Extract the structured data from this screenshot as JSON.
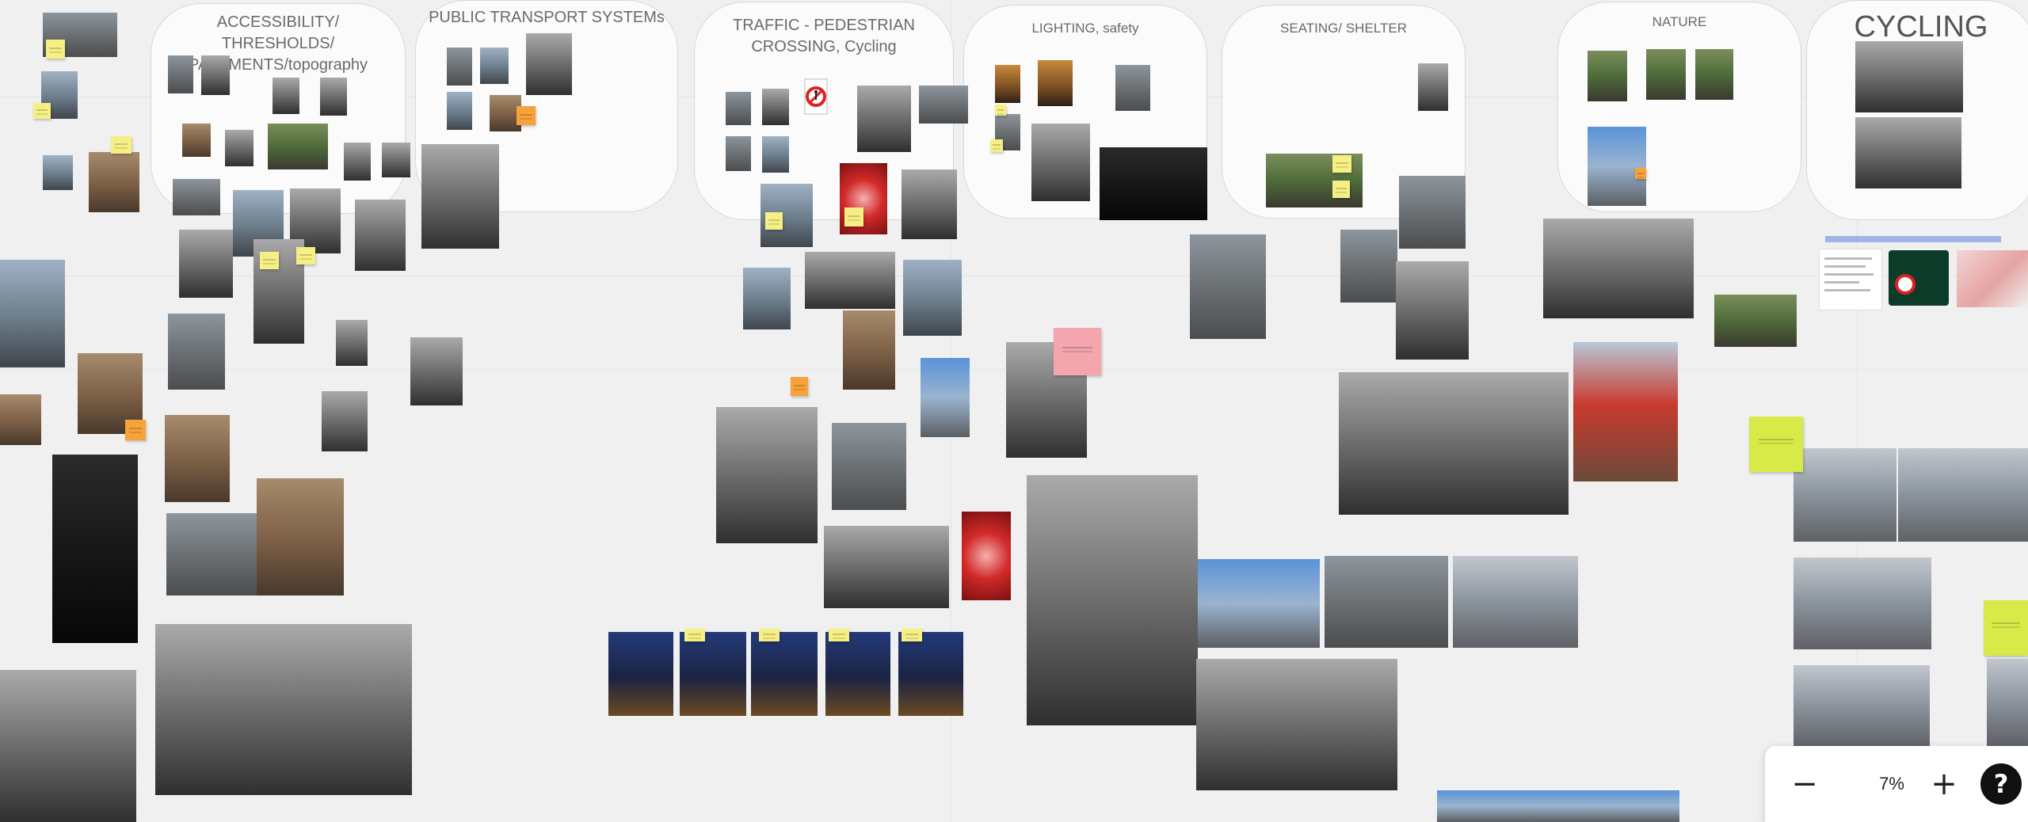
{
  "board": {
    "frames": [
      {
        "id": "accessibility",
        "title": "ACCESSIBILITY/ THRESHOLDS/ PAVEMENTS/topography"
      },
      {
        "id": "public-transport",
        "title": "PUBLIC TRANSPORT SYSTEMs"
      },
      {
        "id": "traffic",
        "title": "TRAFFIC - PEDESTRIAN CROSSING, Cycling"
      },
      {
        "id": "lighting",
        "title": "LIGHTING, safety"
      },
      {
        "id": "seating",
        "title": "SEATING/ SHELTER"
      },
      {
        "id": "nature",
        "title": "NATURE"
      },
      {
        "id": "cycling",
        "title": "CYCLING"
      }
    ]
  },
  "zoom": {
    "zoom_out_label": "−",
    "zoom_level": "7%",
    "zoom_in_label": "+",
    "help_label": "?"
  },
  "icons": [
    "minus-icon",
    "plus-icon",
    "help-icon",
    "no-pedestrian-sign-icon"
  ],
  "colors": {
    "canvas": "#f0f0f0",
    "frame": "#fbfbfb",
    "sticky_yellow": "#f6ef84",
    "sticky_orange": "#f7a23a",
    "sticky_green": "#d8ea48",
    "sticky_pink": "#f4a5ae"
  }
}
